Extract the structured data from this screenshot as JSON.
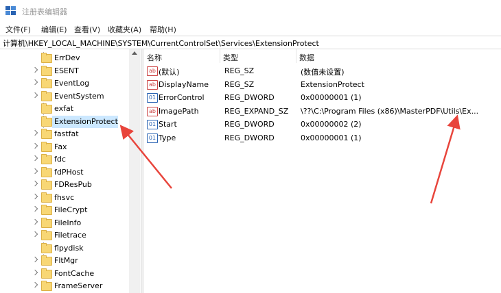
{
  "window": {
    "title": "注册表编辑器"
  },
  "menu": [
    "文件(F)",
    "编辑(E)",
    "查看(V)",
    "收藏夹(A)",
    "帮助(H)"
  ],
  "address": "计算机\\HKEY_LOCAL_MACHINE\\SYSTEM\\CurrentControlSet\\Services\\ExtensionProtect",
  "tree": {
    "items": [
      {
        "label": "ErrDev",
        "expander": false
      },
      {
        "label": "ESENT",
        "expander": true
      },
      {
        "label": "EventLog",
        "expander": true
      },
      {
        "label": "EventSystem",
        "expander": true
      },
      {
        "label": "exfat",
        "expander": false
      },
      {
        "label": "ExtensionProtect",
        "expander": false,
        "selected": true
      },
      {
        "label": "fastfat",
        "expander": true
      },
      {
        "label": "Fax",
        "expander": true
      },
      {
        "label": "fdc",
        "expander": true
      },
      {
        "label": "fdPHost",
        "expander": true
      },
      {
        "label": "FDResPub",
        "expander": true
      },
      {
        "label": "fhsvc",
        "expander": true
      },
      {
        "label": "FileCrypt",
        "expander": true
      },
      {
        "label": "FileInfo",
        "expander": true
      },
      {
        "label": "Filetrace",
        "expander": true
      },
      {
        "label": "flpydisk",
        "expander": false
      },
      {
        "label": "FltMgr",
        "expander": true
      },
      {
        "label": "FontCache",
        "expander": true
      },
      {
        "label": "FrameServer",
        "expander": true
      }
    ]
  },
  "columns": {
    "name": "名称",
    "type": "类型",
    "data": "数据"
  },
  "values": [
    {
      "icon": "string",
      "icon_text": "ab",
      "name": "(默认)",
      "type": "REG_SZ",
      "data": "(数值未设置)"
    },
    {
      "icon": "string",
      "icon_text": "ab",
      "name": "DisplayName",
      "type": "REG_SZ",
      "data": "ExtensionProtect"
    },
    {
      "icon": "binary",
      "icon_text": "01",
      "name": "ErrorControl",
      "type": "REG_DWORD",
      "data": "0x00000001 (1)"
    },
    {
      "icon": "string",
      "icon_text": "ab",
      "name": "ImagePath",
      "type": "REG_EXPAND_SZ",
      "data": "\\??\\C:\\Program Files (x86)\\MasterPDF\\Utils\\Ex..."
    },
    {
      "icon": "binary",
      "icon_text": "01",
      "name": "Start",
      "type": "REG_DWORD",
      "data": "0x00000002 (2)"
    },
    {
      "icon": "binary",
      "icon_text": "01",
      "name": "Type",
      "type": "REG_DWORD",
      "data": "0x00000001 (1)"
    }
  ],
  "colors": {
    "selection": "#cce8ff",
    "annotation_arrow": "#e8453c",
    "folder": "#f8d775"
  }
}
